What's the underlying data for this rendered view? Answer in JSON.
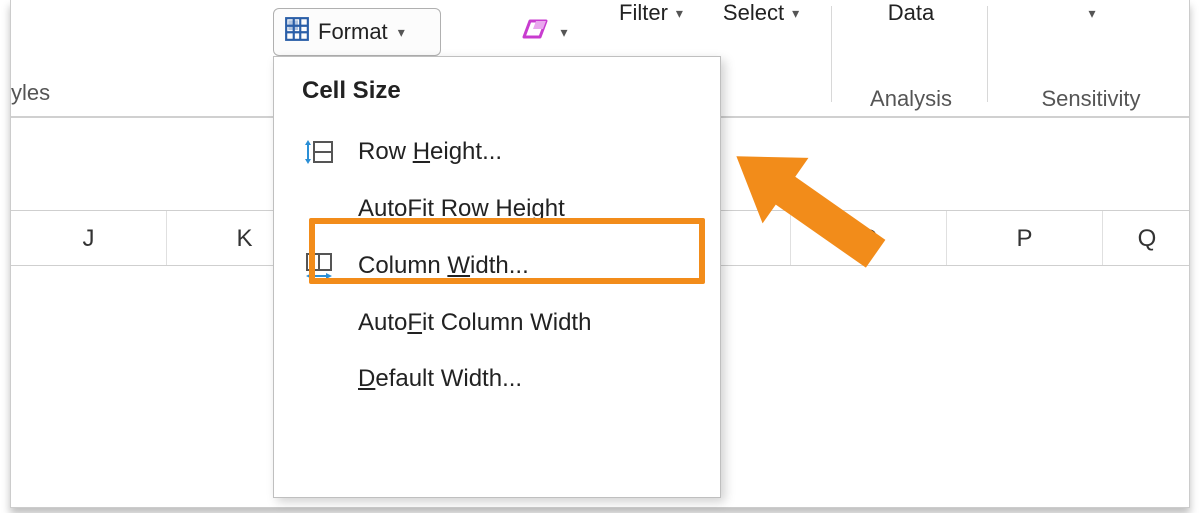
{
  "ribbon": {
    "styles_group_label": "yles",
    "format_label": "Format",
    "filter_top": "Filter",
    "select_top": "Select",
    "data_top": "Data",
    "analysis_label": "Analysis",
    "sensitivity_label": "Sensitivity"
  },
  "columns": [
    "J",
    "K",
    "",
    "",
    "",
    "O",
    "P",
    "Q"
  ],
  "menu": {
    "heading": "Cell Size",
    "items": [
      {
        "pre": "Row ",
        "u": "H",
        "post": "eight...",
        "icon": "row-height"
      },
      {
        "pre": "",
        "u": "A",
        "post": "utoFit Row Height",
        "icon": ""
      },
      {
        "pre": "Column ",
        "u": "W",
        "post": "idth...",
        "icon": "col-width"
      },
      {
        "pre": "Auto",
        "u": "F",
        "post": "it Column Width",
        "icon": ""
      },
      {
        "pre": "",
        "u": "D",
        "post": "efault Width...",
        "icon": ""
      }
    ]
  }
}
